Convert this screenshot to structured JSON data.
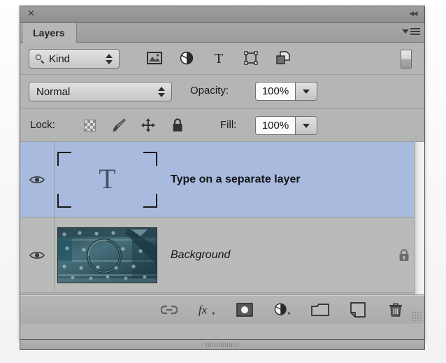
{
  "window": {
    "close_label": "×",
    "collapse_icon": "double-chevron-left",
    "tab_label": "Layers",
    "menu_icon": "panel-menu"
  },
  "filter_row": {
    "kind_label": "Kind",
    "search_icon": "magnifier-icon",
    "stepper_icon": "up-down-stepper",
    "filters": [
      {
        "name": "filter-pixel-layers",
        "icon": "image-icon"
      },
      {
        "name": "filter-adjustment-layers",
        "icon": "half-circle-icon"
      },
      {
        "name": "filter-type-layers",
        "icon": "type-t-icon"
      },
      {
        "name": "filter-shape-layers",
        "icon": "shape-bounds-icon"
      },
      {
        "name": "filter-smart-objects",
        "icon": "smart-object-icon"
      }
    ],
    "toggle_name": "filter-enable-toggle"
  },
  "blend_row": {
    "blend_mode": "Normal",
    "opacity_label": "Opacity:",
    "opacity_value": "100%"
  },
  "lock_row": {
    "lock_label": "Lock:",
    "lock_buttons": [
      {
        "name": "lock-transparent-pixels",
        "icon": "checkerboard-icon"
      },
      {
        "name": "lock-image-pixels",
        "icon": "brush-icon"
      },
      {
        "name": "lock-position",
        "icon": "move-arrows-icon"
      },
      {
        "name": "lock-all",
        "icon": "padlock-icon"
      }
    ],
    "fill_label": "Fill:",
    "fill_value": "100%"
  },
  "layers": [
    {
      "name": "Type on a separate layer",
      "kind": "type",
      "thumbnail_glyph": "T",
      "selected": true,
      "visible": true,
      "locked": false,
      "style": "bold"
    },
    {
      "name": "Background",
      "kind": "image",
      "selected": false,
      "visible": true,
      "locked": true,
      "style": "italic"
    }
  ],
  "bottom_toolbar": [
    {
      "name": "link-layers-button",
      "icon": "link-icon"
    },
    {
      "name": "layer-style-button",
      "icon": "fx-icon"
    },
    {
      "name": "add-layer-mask-button",
      "icon": "mask-icon"
    },
    {
      "name": "new-adjustment-layer-button",
      "icon": "half-circle-icon"
    },
    {
      "name": "new-group-button",
      "icon": "folder-icon"
    },
    {
      "name": "new-layer-button",
      "icon": "new-page-icon"
    },
    {
      "name": "delete-layer-button",
      "icon": "trash-icon"
    }
  ],
  "colors": {
    "panel_bg": "#b4b6b4",
    "selection_blue": "#a8bbdf",
    "row_bg": "#b9bbb9",
    "border": "#58595a",
    "text": "#151515"
  }
}
